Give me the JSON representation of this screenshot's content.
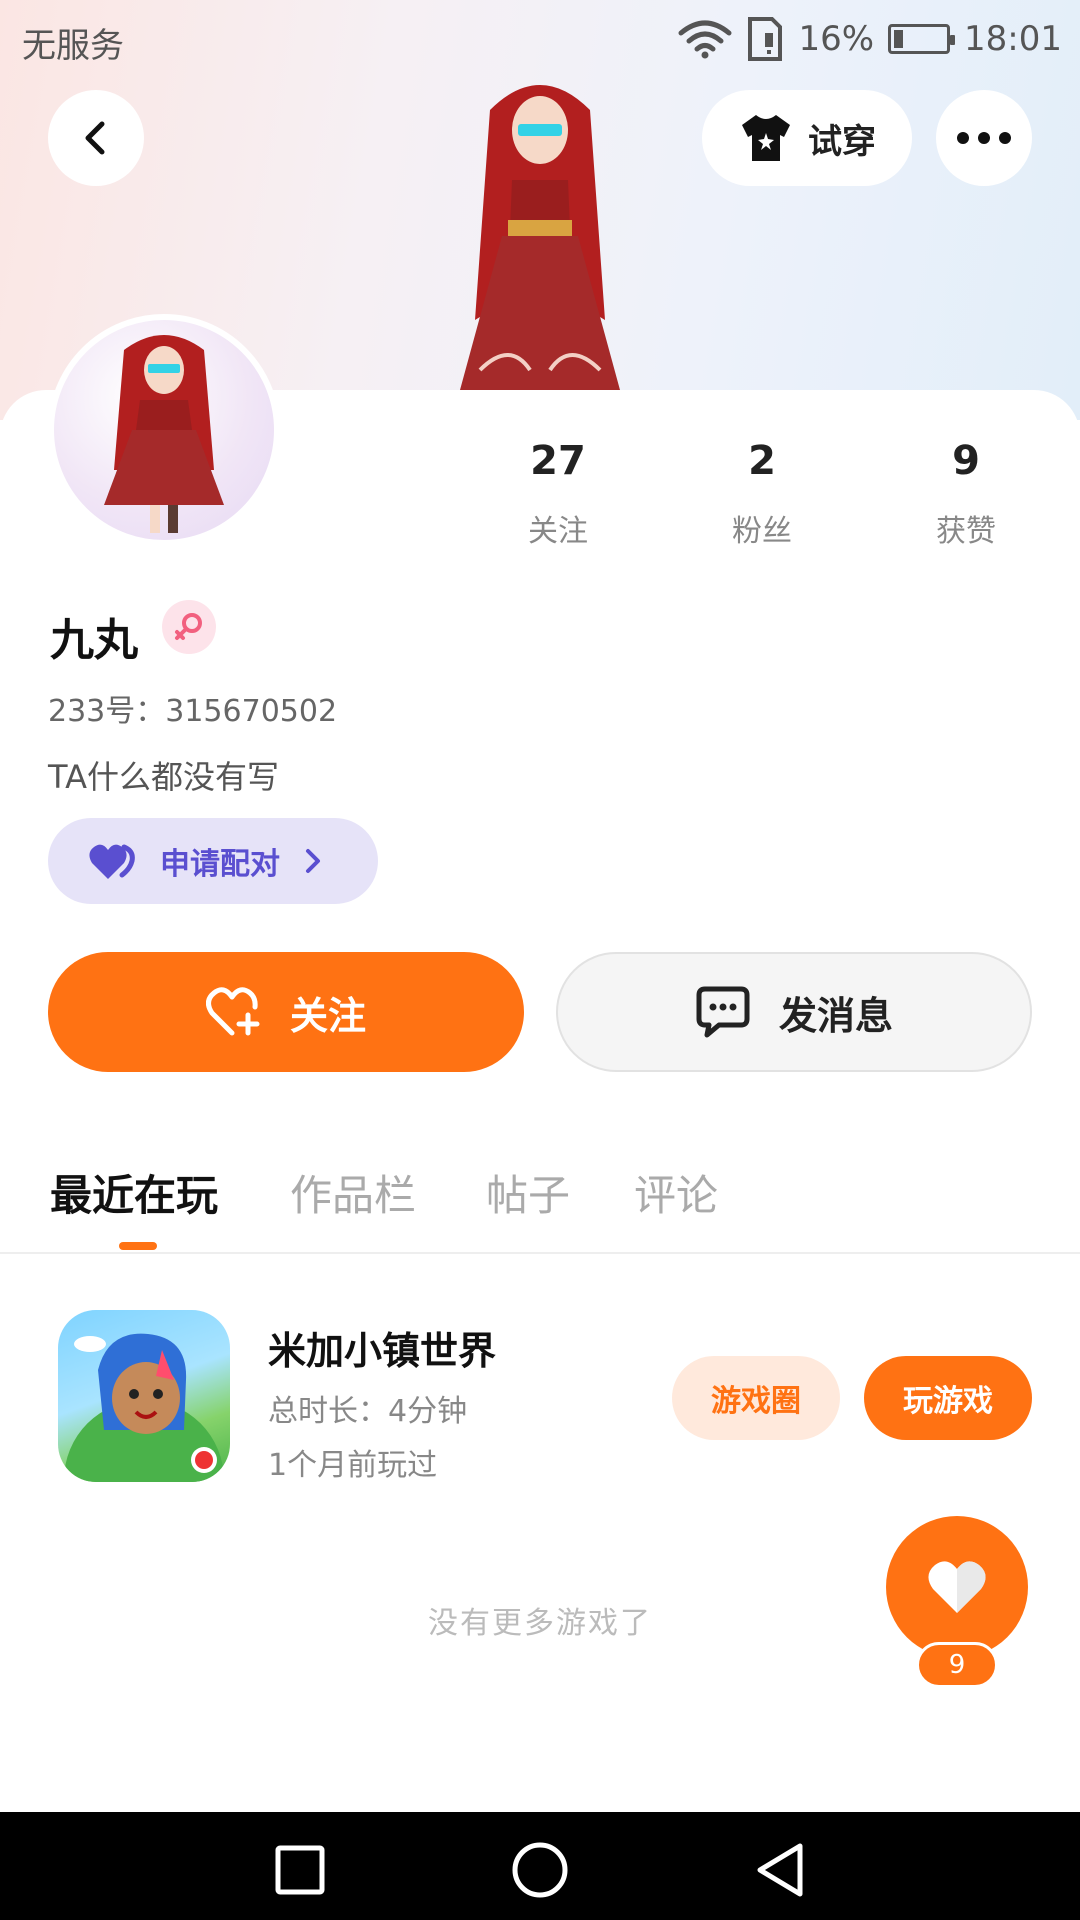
{
  "status_bar": {
    "carrier": "无服务",
    "battery_percent": "16%",
    "battery_level": 0.16,
    "time": "18:01"
  },
  "header": {
    "tryon_label": "试穿",
    "back_icon": "chevron-left-icon",
    "more_icon": "more-horizontal-icon",
    "tryon_icon": "tshirt-icon"
  },
  "profile": {
    "stats": [
      {
        "value": "27",
        "label": "关注"
      },
      {
        "value": "2",
        "label": "粉丝"
      },
      {
        "value": "9",
        "label": "获赞"
      }
    ],
    "name": "九丸",
    "gender_icon": "female-icon",
    "uid": "233号：315670502",
    "bio": "TA什么都没有写",
    "pair_label": "申请配对"
  },
  "actions": {
    "follow_label": "关注",
    "message_label": "发消息"
  },
  "tabs": [
    {
      "label": "最近在玩",
      "active": true
    },
    {
      "label": "作品栏",
      "active": false
    },
    {
      "label": "帖子",
      "active": false
    },
    {
      "label": "评论",
      "active": false
    }
  ],
  "games": [
    {
      "title": "米加小镇世界",
      "duration": "总时长：4分钟",
      "last_played": "1个月前玩过",
      "circle_label": "游戏圈",
      "play_label": "玩游戏"
    }
  ],
  "empty_text": "没有更多游戏了",
  "like": {
    "count": "9"
  },
  "colors": {
    "accent": "#ff7213",
    "pair_bg": "#e6e3f8",
    "pair_text": "#5a4fd0"
  }
}
